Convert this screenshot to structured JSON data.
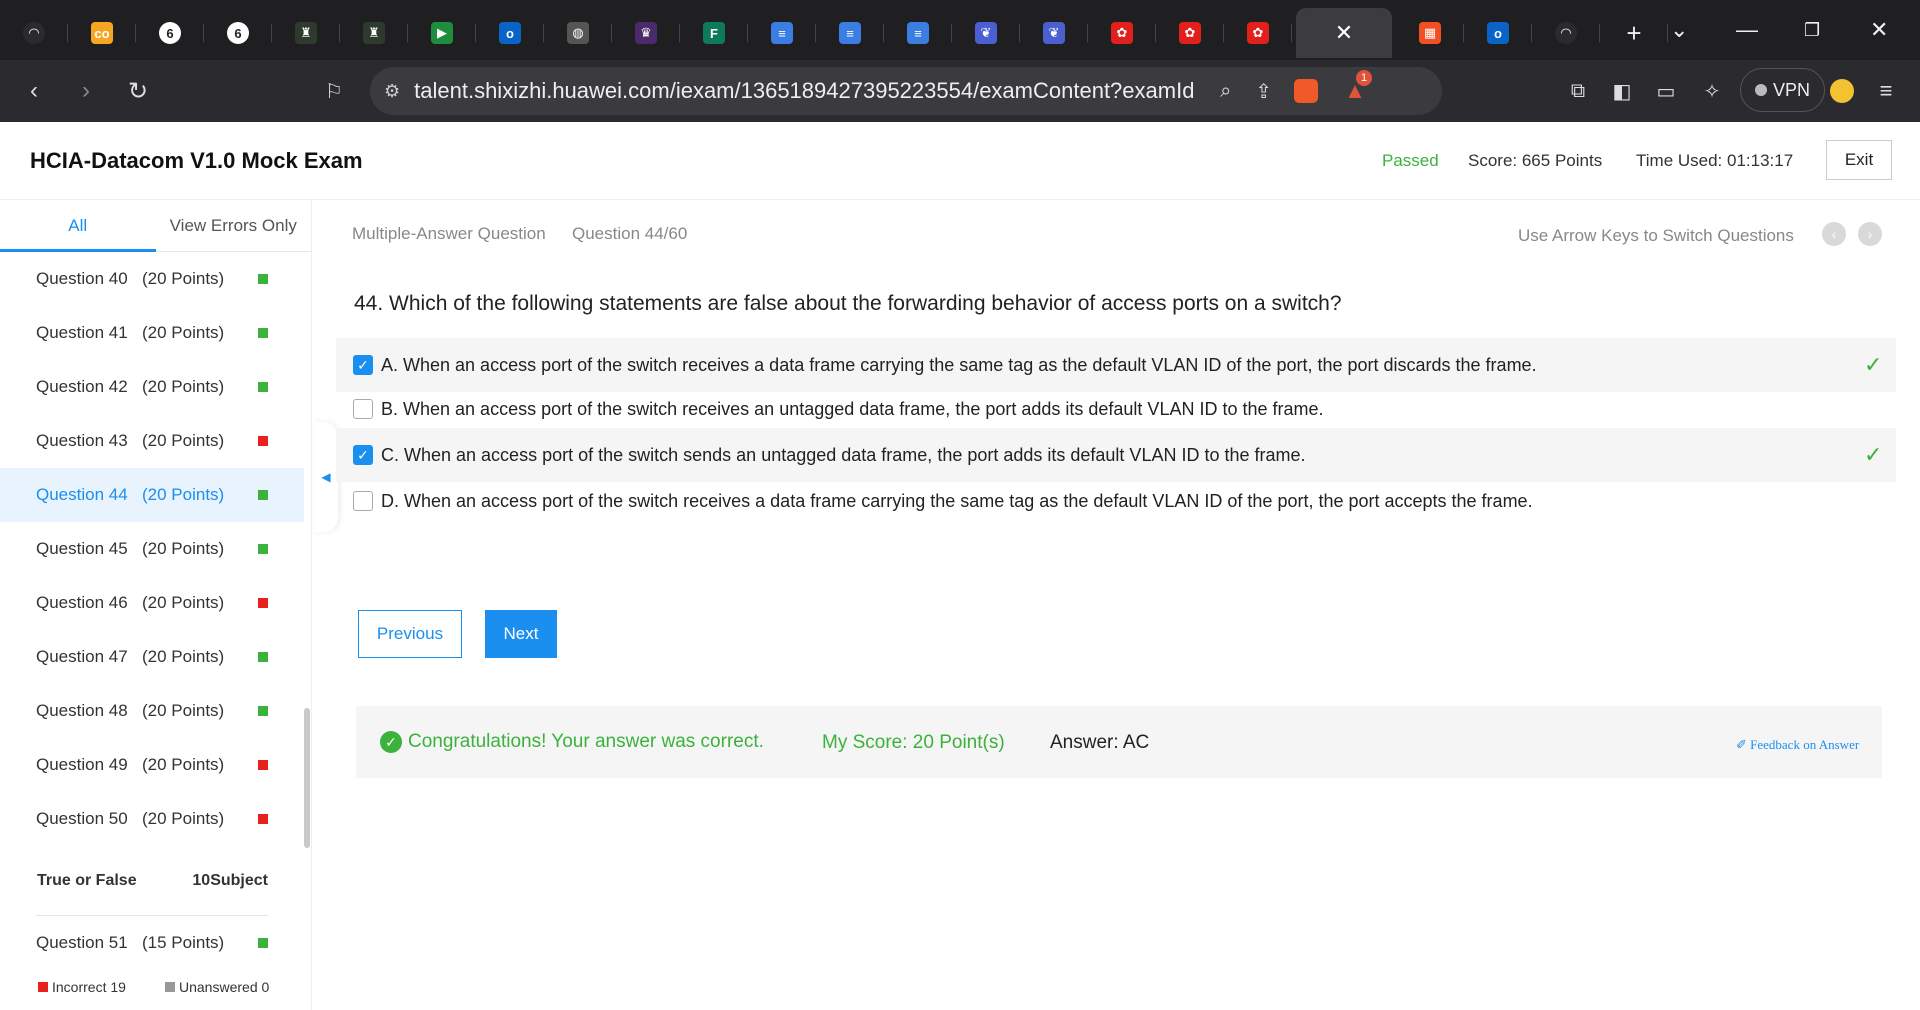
{
  "browser": {
    "tabs": [
      {
        "icon": "gauge-icon",
        "color": "#2b2b2f",
        "glyph": "◠"
      },
      {
        "icon": "coursera-icon",
        "color": "#f5a623",
        "glyph": "co"
      },
      {
        "icon": "circle-6-icon",
        "color": "#ffffff",
        "glyph": "6"
      },
      {
        "icon": "circle-6-icon",
        "color": "#ffffff",
        "glyph": "6"
      },
      {
        "icon": "crest-icon",
        "color": "#2f3a2f",
        "glyph": "♜"
      },
      {
        "icon": "crest-icon",
        "color": "#2f3a2f",
        "glyph": "♜"
      },
      {
        "icon": "meet-icon",
        "color": "#1e8e3e",
        "glyph": "▶"
      },
      {
        "icon": "outlook-icon",
        "color": "#0a64c8",
        "glyph": "o"
      },
      {
        "icon": "globe-icon",
        "color": "#555555",
        "glyph": "◍"
      },
      {
        "icon": "university-icon",
        "color": "#4b2a6b",
        "glyph": "♛"
      },
      {
        "icon": "forms-icon",
        "color": "#0e7a5c",
        "glyph": "F"
      },
      {
        "icon": "docs-icon",
        "color": "#3b7de0",
        "glyph": "≡"
      },
      {
        "icon": "docs-icon",
        "color": "#3b7de0",
        "glyph": "≡"
      },
      {
        "icon": "docs-icon",
        "color": "#3b7de0",
        "glyph": "≡"
      },
      {
        "icon": "bird-icon",
        "color": "#4a5fd0",
        "glyph": "❦"
      },
      {
        "icon": "bird-icon",
        "color": "#4a5fd0",
        "glyph": "❦"
      },
      {
        "icon": "huawei-icon",
        "color": "#e0201d",
        "glyph": "✿"
      },
      {
        "icon": "huawei-icon",
        "color": "#e0201d",
        "glyph": "✿"
      },
      {
        "icon": "huawei-icon",
        "color": "#e0201d",
        "glyph": "✿"
      }
    ],
    "active_tab_close": "✕",
    "after_tabs": [
      {
        "icon": "microsoft-icon",
        "color": "#f25022",
        "glyph": "▦"
      },
      {
        "icon": "outlook-icon",
        "color": "#0a64c8",
        "glyph": "o"
      },
      {
        "icon": "gauge-icon",
        "color": "#2b2b2f",
        "glyph": "◠"
      }
    ],
    "new_tab": "+",
    "url": "talent.shixizhi.huawei.com/iexam/1365189427395223554/examContent?examId=1...",
    "vpn_label": "VPN",
    "notification_count": "1"
  },
  "header": {
    "title": "HCIA-Datacom V1.0 Mock Exam",
    "status": "Passed",
    "score": "Score: 665 Points",
    "time_used": "Time Used: 01:13:17",
    "exit_label": "Exit"
  },
  "sidebar": {
    "tab_all": "All",
    "tab_errors": "View Errors Only",
    "questions": [
      {
        "label": "Question 40",
        "points": "(20 Points)",
        "status": "correct"
      },
      {
        "label": "Question 41",
        "points": "(20 Points)",
        "status": "correct"
      },
      {
        "label": "Question 42",
        "points": "(20 Points)",
        "status": "correct"
      },
      {
        "label": "Question 43",
        "points": "(20 Points)",
        "status": "incorrect"
      },
      {
        "label": "Question 44",
        "points": "(20 Points)",
        "status": "correct"
      },
      {
        "label": "Question 45",
        "points": "(20 Points)",
        "status": "correct"
      },
      {
        "label": "Question 46",
        "points": "(20 Points)",
        "status": "incorrect"
      },
      {
        "label": "Question 47",
        "points": "(20 Points)",
        "status": "correct"
      },
      {
        "label": "Question 48",
        "points": "(20 Points)",
        "status": "correct"
      },
      {
        "label": "Question 49",
        "points": "(20 Points)",
        "status": "incorrect"
      },
      {
        "label": "Question 50",
        "points": "(20 Points)",
        "status": "incorrect"
      }
    ],
    "section": {
      "label": "True or False",
      "count": "10Subject"
    },
    "after_section": [
      {
        "label": "Question 51",
        "points": "(15 Points)",
        "status": "correct"
      }
    ],
    "legend_incorrect": "Incorrect 19",
    "legend_unanswered": "Unanswered 0",
    "colors": {
      "correct": "#3bb23b",
      "incorrect": "#e8211d",
      "unanswered": "#999999"
    }
  },
  "main": {
    "type": "Multiple-Answer Question",
    "number": "Question 44/60",
    "hint": "Use Arrow Keys to Switch Questions",
    "question": "44. Which of the following statements are false about the forwarding behavior of access ports on a switch?",
    "options": [
      {
        "text": "A. When an access port of the switch receives a data frame carrying the same tag as the default VLAN ID of the port, the port discards the frame.",
        "checked": true
      },
      {
        "text": "B. When an access port of the switch receives an untagged data frame, the port adds its default VLAN ID to the frame.",
        "checked": false
      },
      {
        "text": "C. When an access port of the switch sends an untagged data frame, the port adds its default VLAN ID to the frame.",
        "checked": true
      },
      {
        "text": "D. When an access port of the switch receives a data frame carrying the same tag as the default VLAN ID of the port, the port accepts the frame.",
        "checked": false
      }
    ],
    "prev_label": "Previous",
    "next_label": "Next",
    "result_message": "Congratulations! Your answer was correct.",
    "my_score": "My Score: 20 Point(s)",
    "answer": "Answer: AC",
    "feedback": "✐ Feedback on Answer"
  }
}
